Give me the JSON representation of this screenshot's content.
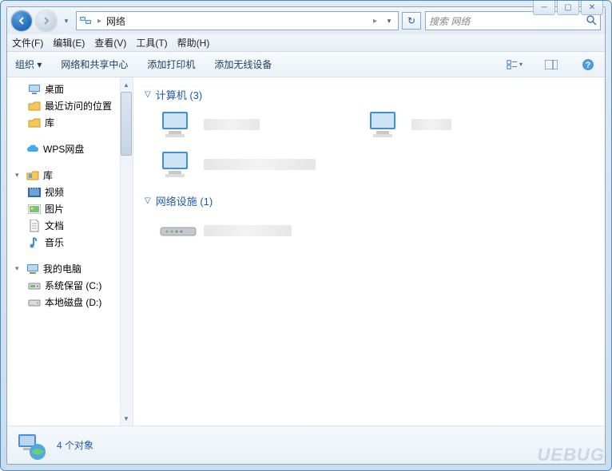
{
  "window": {
    "minimize": "─",
    "maximize": "▢",
    "close": "✕"
  },
  "nav": {
    "location": "网络",
    "dropdown_arrow": "▾",
    "path_arrow": "▸",
    "refresh": "↻",
    "search_placeholder": "搜索 网络"
  },
  "menu": {
    "file": "文件(F)",
    "edit": "编辑(E)",
    "view": "查看(V)",
    "tools": "工具(T)",
    "help": "帮助(H)"
  },
  "toolbar": {
    "organize": "组织 ▾",
    "network_center": "网络和共享中心",
    "add_printer": "添加打印机",
    "add_wireless": "添加无线设备"
  },
  "tree": {
    "desktop": "桌面",
    "recent": "最近访问的位置",
    "libraries_top": "库",
    "wps": "WPS网盘",
    "libraries": "库",
    "videos": "视频",
    "pictures": "图片",
    "documents": "文档",
    "music": "音乐",
    "computer": "我的电脑",
    "drive_c": "系统保留 (C:)",
    "drive_d": "本地磁盘 (D:)"
  },
  "sections": {
    "computers": "计算机 (3)",
    "network_devices": "网络设施 (1)"
  },
  "status": {
    "count": "4 个对象"
  },
  "watermark": "UEBUG"
}
